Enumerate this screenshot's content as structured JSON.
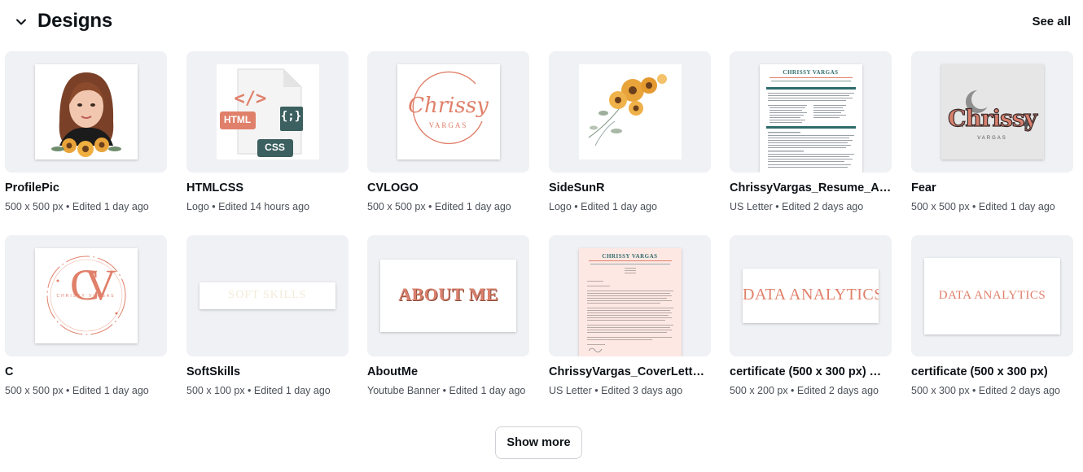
{
  "section": {
    "title": "Designs",
    "see_all_label": "See all",
    "collapse_icon": "chevron-down-icon"
  },
  "designs": [
    {
      "title": "ProfilePic",
      "meta": "500 x 500 px • Edited 1 day ago"
    },
    {
      "title": "HTMLCSS",
      "meta": "Logo • Edited 14 hours ago",
      "badges": {
        "html": "HTML",
        "css": "CSS",
        "code": "</>",
        "brace": "{;}"
      }
    },
    {
      "title": "CVLOGO",
      "meta": "500 x 500 px • Edited 1 day ago",
      "logo": {
        "script": "Chrissy",
        "caps": "VARGAS"
      }
    },
    {
      "title": "SideSunR",
      "meta": "Logo • Edited 1 day ago"
    },
    {
      "title": "ChrissyVargas_Resume_A…",
      "meta": "US Letter • Edited 2 days ago",
      "doc_heading": "CHRISSY VARGAS"
    },
    {
      "title": "Fear",
      "meta": "500 x 500 px • Edited 1 day ago",
      "logo": {
        "text": "Chrissy",
        "small": "VARGAS"
      }
    },
    {
      "title": "C",
      "meta": "500 x 500 px • Edited 1 day ago",
      "logo": {
        "letters": "CV",
        "small": "CHRISSY VARGAS"
      }
    },
    {
      "title": "SoftSkills",
      "meta": "500 x 100 px • Edited 1 day ago",
      "banner_text": "SOFT SKILLS"
    },
    {
      "title": "AboutMe",
      "meta": "Youtube Banner • Edited 1 day ago",
      "banner_text": "ABOUT ME"
    },
    {
      "title": "ChrissyVargas_CoverLette…",
      "meta": "US Letter • Edited 3 days ago",
      "doc_heading": "CHRISSY VARGAS"
    },
    {
      "title": "certificate (500 x 300 px) …",
      "meta": "500 x 200 px • Edited 2 days ago",
      "banner_text": "DATA ANALYTICS"
    },
    {
      "title": "certificate (500 x 300 px)",
      "meta": "500 x 300 px • Edited 2 days ago",
      "banner_text": "DATA ANALYTICS"
    }
  ],
  "show_more_label": "Show more",
  "colors": {
    "salmon": "#e0806a",
    "teal": "#2e6b6b",
    "card_bg": "#f0f1f5"
  }
}
